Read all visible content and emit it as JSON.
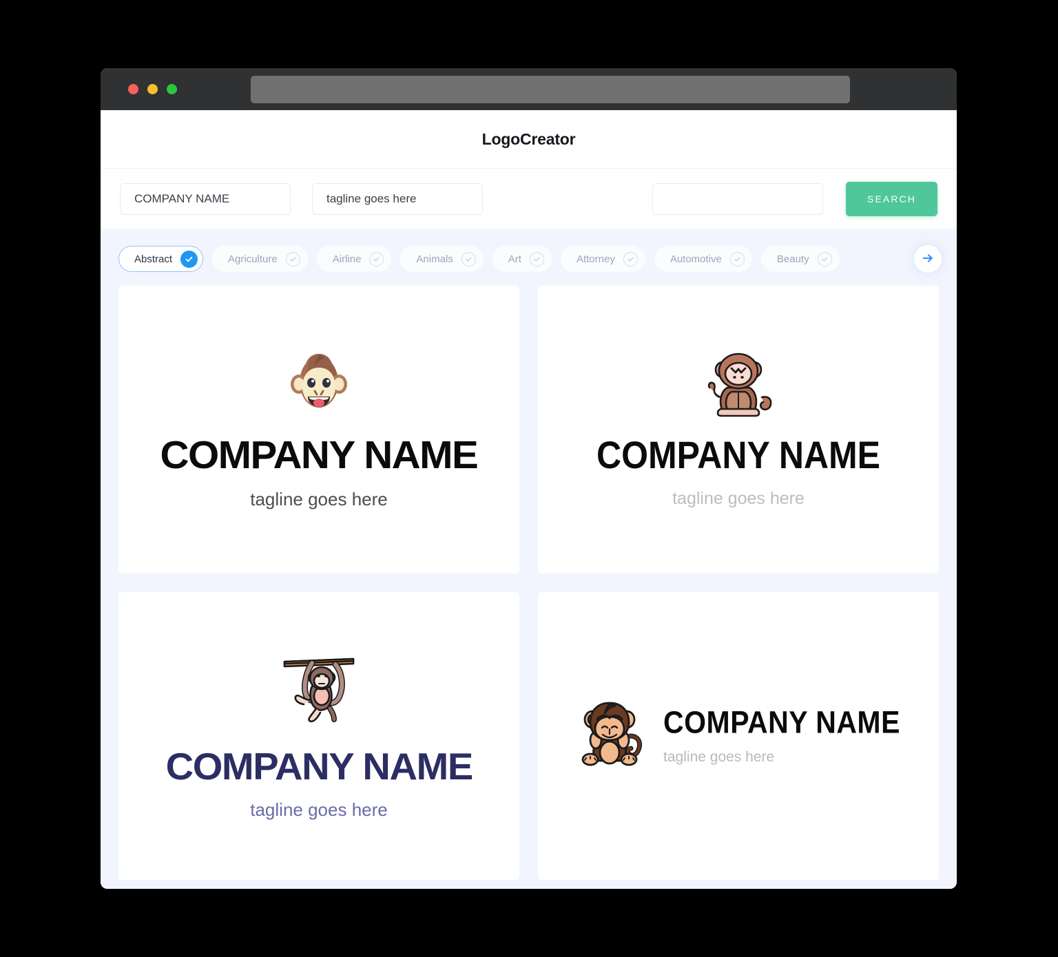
{
  "window": {
    "traffic_lights": [
      "close",
      "minimize",
      "maximize"
    ],
    "url_value": ""
  },
  "header": {
    "brand": "LogoCreator"
  },
  "search": {
    "company_value": "COMPANY NAME",
    "company_placeholder": "COMPANY NAME",
    "tagline_value": "tagline goes here",
    "tagline_placeholder": "tagline goes here",
    "extra_value": "",
    "extra_placeholder": "",
    "button_label": "SEARCH",
    "button_color": "#4fc79b"
  },
  "filters": {
    "active_color": "#2196f3",
    "next_arrow_icon": "arrow-right-icon",
    "items": [
      {
        "label": "Abstract",
        "selected": true
      },
      {
        "label": "Agriculture",
        "selected": false
      },
      {
        "label": "Airline",
        "selected": false
      },
      {
        "label": "Animals",
        "selected": false
      },
      {
        "label": "Art",
        "selected": false
      },
      {
        "label": "Attorney",
        "selected": false
      },
      {
        "label": "Automotive",
        "selected": false
      },
      {
        "label": "Beauty",
        "selected": false
      }
    ]
  },
  "results": {
    "cards": [
      {
        "icon": "monkey-face-icon",
        "name": "COMPANY NAME",
        "tagline": "tagline goes here",
        "name_color": "#0b0b0b",
        "tagline_color": "#4d4d4d",
        "layout": "stacked"
      },
      {
        "icon": "sitting-monkey-waving-icon",
        "name": "COMPANY NAME",
        "tagline": "tagline goes here",
        "name_color": "#0b0b0b",
        "tagline_color": "#bdbdbd",
        "layout": "stacked"
      },
      {
        "icon": "hanging-monkey-branch-icon",
        "name": "COMPANY NAME",
        "tagline": "tagline goes here",
        "name_color": "#2c2e63",
        "tagline_color": "#6a6ca8",
        "layout": "stacked"
      },
      {
        "icon": "sitting-monkey-icon",
        "name": "COMPANY NAME",
        "tagline": "tagline goes here",
        "name_color": "#0b0b0b",
        "tagline_color": "#b9b9b9",
        "layout": "horizontal"
      }
    ]
  }
}
